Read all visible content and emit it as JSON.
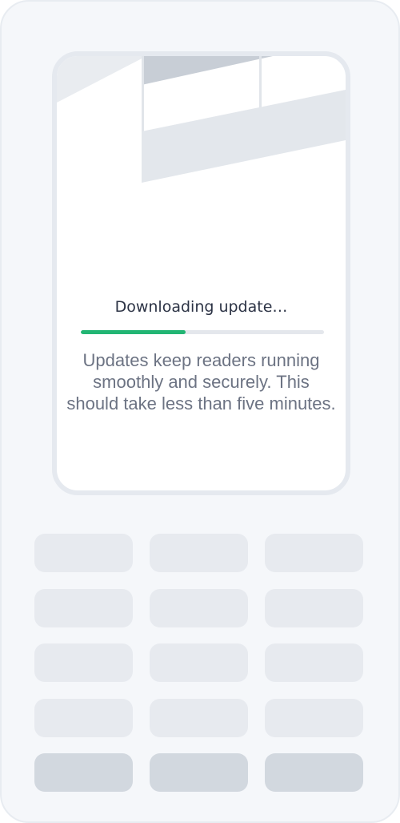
{
  "update_screen": {
    "title": "Downloading update…",
    "progress_fraction": 0.43,
    "message": "Updates keep readers running smoothly and securely. This should take less than five minutes."
  },
  "colors": {
    "progress_fill": "#22b573",
    "progress_track": "#e4e7ec",
    "title_text": "#2c3345",
    "message_text": "#6c7383",
    "device_background": "#f5f7fa",
    "key_light": "#e7eaef",
    "key_dark": "#d2d8df"
  },
  "keypad": {
    "rows": 5,
    "columns": 3,
    "dark_row_index": 4
  }
}
